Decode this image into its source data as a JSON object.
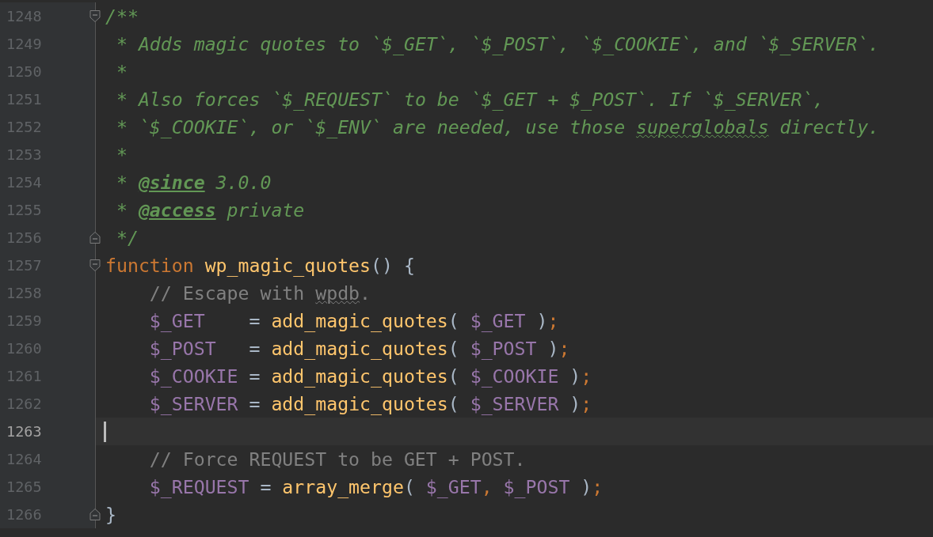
{
  "editor": {
    "lines": [
      {
        "number": "1248",
        "fold": {
          "kind": "start"
        },
        "current": false,
        "indented": false,
        "tokens": [
          {
            "text": "/**",
            "kind": "doc"
          }
        ]
      },
      {
        "number": "1249",
        "current": false,
        "indented": false,
        "tokens": [
          {
            "text": " * Adds magic quotes to `$_GET`, `$_POST`, `$_COOKIE`, and `$_SERVER`.",
            "kind": "doc"
          }
        ]
      },
      {
        "number": "1250",
        "current": false,
        "indented": false,
        "tokens": [
          {
            "text": " *",
            "kind": "doc"
          }
        ]
      },
      {
        "number": "1251",
        "current": false,
        "indented": false,
        "tokens": [
          {
            "text": " * Also forces `$_REQUEST` to be `$_GET + $_POST`. If `$_SERVER`,",
            "kind": "doc"
          }
        ]
      },
      {
        "number": "1252",
        "current": false,
        "indented": false,
        "tokens": [
          {
            "text": " * `$_COOKIE`, or `$_ENV` are needed, use those ",
            "kind": "doc"
          },
          {
            "text": "superglobals",
            "kind": "doc-typo"
          },
          {
            "text": " directly.",
            "kind": "doc"
          }
        ]
      },
      {
        "number": "1253",
        "current": false,
        "indented": false,
        "tokens": [
          {
            "text": " *",
            "kind": "doc"
          }
        ]
      },
      {
        "number": "1254",
        "current": false,
        "indented": false,
        "tokens": [
          {
            "text": " * ",
            "kind": "doc"
          },
          {
            "text": "@since",
            "kind": "doc-tag"
          },
          {
            "text": " 3.0.0",
            "kind": "doc"
          }
        ]
      },
      {
        "number": "1255",
        "current": false,
        "indented": false,
        "tokens": [
          {
            "text": " * ",
            "kind": "doc"
          },
          {
            "text": "@access",
            "kind": "doc-tag"
          },
          {
            "text": " private",
            "kind": "doc"
          }
        ]
      },
      {
        "number": "1256",
        "fold": {
          "kind": "end"
        },
        "current": false,
        "indented": false,
        "tokens": [
          {
            "text": " */",
            "kind": "doc"
          }
        ]
      },
      {
        "number": "1257",
        "fold": {
          "kind": "start"
        },
        "current": false,
        "indented": false,
        "tokens": [
          {
            "text": "function ",
            "kind": "keyword"
          },
          {
            "text": "wp_magic_quotes",
            "kind": "function"
          },
          {
            "text": "() {",
            "kind": "plain"
          }
        ]
      },
      {
        "number": "1258",
        "current": false,
        "indented": true,
        "tokens": [
          {
            "text": "// Escape with ",
            "kind": "comment"
          },
          {
            "text": "wpdb",
            "kind": "comment-typo"
          },
          {
            "text": ".",
            "kind": "comment"
          }
        ]
      },
      {
        "number": "1259",
        "current": false,
        "indented": true,
        "tokens": [
          {
            "text": "$_GET",
            "kind": "variable"
          },
          {
            "text": "    = ",
            "kind": "plain"
          },
          {
            "text": "add_magic_quotes",
            "kind": "function"
          },
          {
            "text": "( ",
            "kind": "plain"
          },
          {
            "text": "$_GET",
            "kind": "variable"
          },
          {
            "text": " )",
            "kind": "plain"
          },
          {
            "text": ";",
            "kind": "keyword"
          }
        ]
      },
      {
        "number": "1260",
        "current": false,
        "indented": true,
        "tokens": [
          {
            "text": "$_POST",
            "kind": "variable"
          },
          {
            "text": "   = ",
            "kind": "plain"
          },
          {
            "text": "add_magic_quotes",
            "kind": "function"
          },
          {
            "text": "( ",
            "kind": "plain"
          },
          {
            "text": "$_POST",
            "kind": "variable"
          },
          {
            "text": " )",
            "kind": "plain"
          },
          {
            "text": ";",
            "kind": "keyword"
          }
        ]
      },
      {
        "number": "1261",
        "current": false,
        "indented": true,
        "tokens": [
          {
            "text": "$_COOKIE",
            "kind": "variable"
          },
          {
            "text": " = ",
            "kind": "plain"
          },
          {
            "text": "add_magic_quotes",
            "kind": "function"
          },
          {
            "text": "( ",
            "kind": "plain"
          },
          {
            "text": "$_COOKIE",
            "kind": "variable"
          },
          {
            "text": " )",
            "kind": "plain"
          },
          {
            "text": ";",
            "kind": "keyword"
          }
        ]
      },
      {
        "number": "1262",
        "current": false,
        "indented": true,
        "tokens": [
          {
            "text": "$_SERVER",
            "kind": "variable"
          },
          {
            "text": " = ",
            "kind": "plain"
          },
          {
            "text": "add_magic_quotes",
            "kind": "function"
          },
          {
            "text": "( ",
            "kind": "plain"
          },
          {
            "text": "$_SERVER",
            "kind": "variable"
          },
          {
            "text": " )",
            "kind": "plain"
          },
          {
            "text": ";",
            "kind": "keyword"
          }
        ]
      },
      {
        "number": "1263",
        "current": true
      },
      {
        "number": "1264",
        "current": false,
        "indented": true,
        "tokens": [
          {
            "text": "// Force REQUEST to be GET + POST.",
            "kind": "comment"
          }
        ]
      },
      {
        "number": "1265",
        "current": false,
        "indented": true,
        "tokens": [
          {
            "text": "$_REQUEST",
            "kind": "variable"
          },
          {
            "text": " = ",
            "kind": "plain"
          },
          {
            "text": "array_merge",
            "kind": "function"
          },
          {
            "text": "( ",
            "kind": "plain"
          },
          {
            "text": "$_GET",
            "kind": "variable"
          },
          {
            "text": ", ",
            "kind": "keyword"
          },
          {
            "text": "$_POST",
            "kind": "variable"
          },
          {
            "text": " )",
            "kind": "plain"
          },
          {
            "text": ";",
            "kind": "keyword"
          }
        ]
      },
      {
        "number": "1266",
        "fold": {
          "kind": "end"
        },
        "current": false,
        "indented": false,
        "tokens": [
          {
            "text": "}",
            "kind": "plain"
          }
        ]
      }
    ]
  }
}
